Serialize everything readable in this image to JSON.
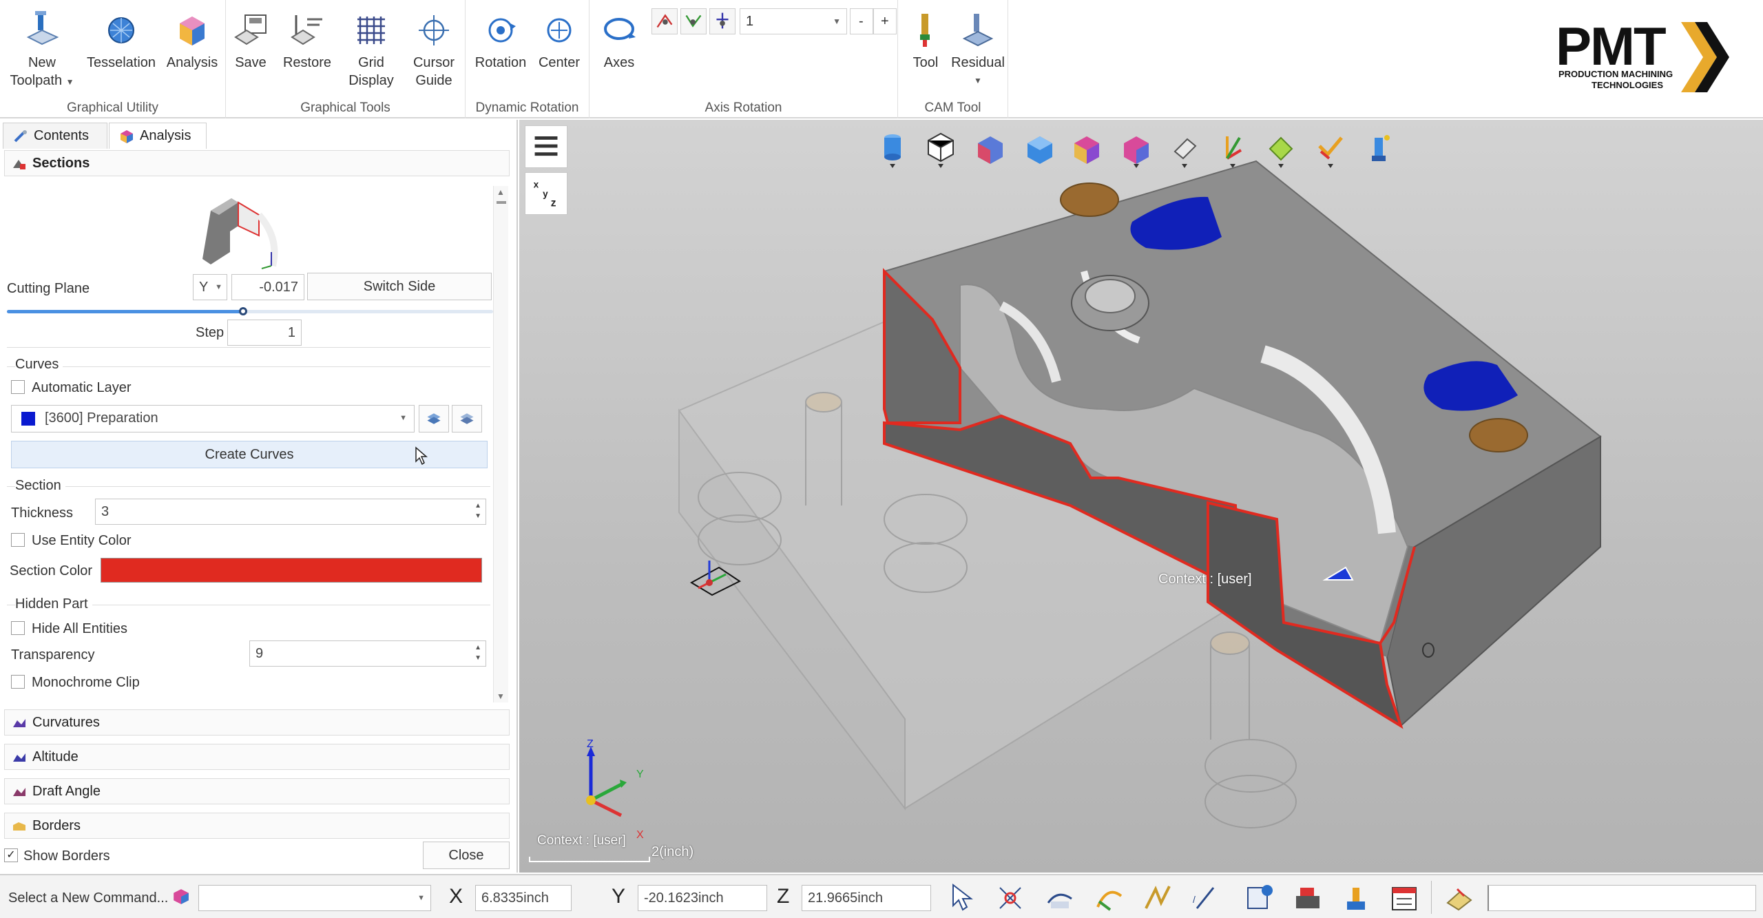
{
  "ribbon": {
    "groups": {
      "graphical_utility": "Graphical Utility",
      "graphical_tools": "Graphical Tools",
      "dynamic_rotation": "Dynamic Rotation",
      "axis_rotation": "Axis Rotation",
      "cam_tool": "CAM Tool"
    },
    "buttons": {
      "new_toolpath_line1": "New",
      "new_toolpath_line2": "Toolpath",
      "tesselation": "Tesselation",
      "analysis": "Analysis",
      "save": "Save",
      "restore": "Restore",
      "grid_display_line1": "Grid",
      "grid_display_line2": "Display",
      "cursor_guide_line1": "Cursor",
      "cursor_guide_line2": "Guide",
      "rotation": "Rotation",
      "center": "Center",
      "axes": "Axes",
      "tool": "Tool",
      "residual": "Residual"
    },
    "axis_rotation_value": "1",
    "minus_label": "-",
    "plus_label": "+"
  },
  "logo": {
    "text": "PMT",
    "tagline_line1": "PRODUCTION MACHINING",
    "tagline_line2": "TECHNOLOGIES"
  },
  "left_panel": {
    "tabs": [
      "Contents",
      "Analysis"
    ],
    "active_tab": "Analysis",
    "sections_header": "Sections",
    "cutting_plane": {
      "label": "Cutting Plane",
      "axis": "Y",
      "value": "-0.017",
      "switch_side": "Switch Side",
      "slider_fraction": 0.49
    },
    "step": {
      "label": "Step",
      "value": "1"
    },
    "curves": {
      "title": "Curves",
      "automatic_layer": "Automatic Layer",
      "layer_value": "[3600] Preparation",
      "create_curves": "Create Curves"
    },
    "section": {
      "title": "Section",
      "thickness_label": "Thickness",
      "thickness_value": "3",
      "use_entity_color": "Use Entity Color",
      "section_color_label": "Section Color",
      "section_color": "#e02a20"
    },
    "hidden_part": {
      "title": "Hidden Part",
      "hide_all": "Hide All Entities",
      "transparency_label": "Transparency",
      "transparency_value": "9",
      "monochrome_clip": "Monochrome Clip"
    },
    "collapsed_sections": [
      "Curvatures",
      "Altitude",
      "Draft Angle",
      "Borders"
    ],
    "show_borders": "Show Borders",
    "show_borders_checked": true,
    "close": "Close"
  },
  "viewport": {
    "context_label": "Context : [user]",
    "triad_context": "Context : [user]",
    "scale_label": "2(inch)",
    "axis_x": "X",
    "axis_y": "Y",
    "axis_z": "Z",
    "xyz_button": "XYZ",
    "accent_section": "#e02a20",
    "accent_blue": "#1020b8",
    "accent_bronze": "#9a6a30"
  },
  "status_bar": {
    "command_prompt": "Select a New Command...",
    "x_label": "X",
    "x_value": "6.8335inch",
    "y_label": "Y",
    "y_value": "-20.1623inch",
    "z_label": "Z",
    "z_value": "21.9665inch"
  }
}
